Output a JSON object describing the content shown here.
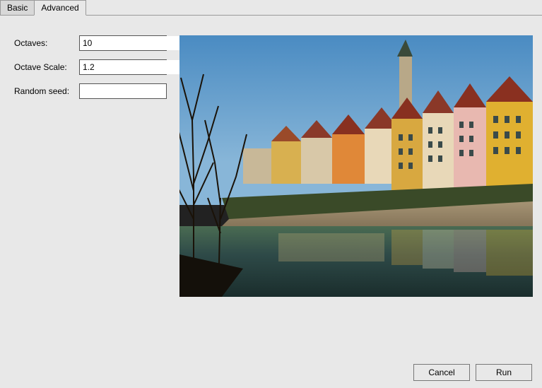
{
  "tabs": {
    "basic": "Basic",
    "advanced": "Advanced",
    "active": "advanced"
  },
  "form": {
    "octaves_label": "Octaves:",
    "octaves_value": "10",
    "scale_label": "Octave Scale:",
    "scale_value": "1.2",
    "seed_label": "Random seed:",
    "seed_value": ""
  },
  "buttons": {
    "cancel": "Cancel",
    "run": "Run"
  },
  "preview": {
    "description": "European riverside town with colorful gabled houses, church tower, bare winter trees, and reflections in calm water under blue sky"
  }
}
